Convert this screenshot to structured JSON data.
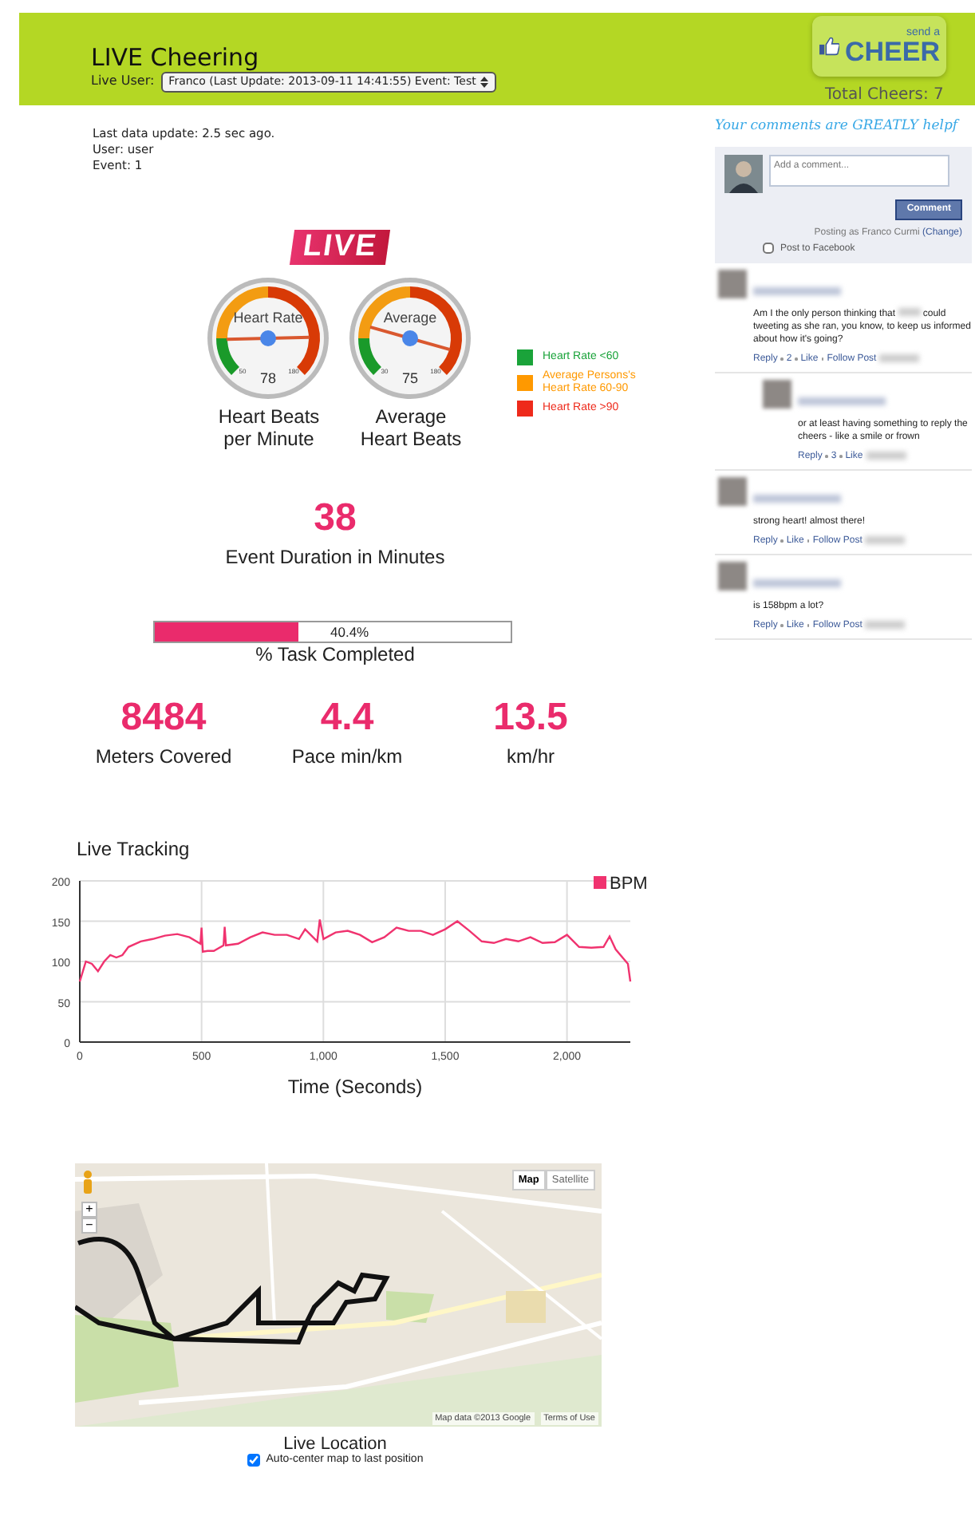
{
  "header": {
    "title": "LIVE Cheering",
    "user_label": "Live User:",
    "user_select": "Franco (Last Update: 2013-09-11 14:41:55) Event: Test",
    "cheer_button": {
      "small": "send a",
      "big": "CHEER"
    },
    "total_cheers": "Total Cheers: 7"
  },
  "info": [
    "Last data update: 2.5 sec ago.",
    "User: user",
    "Event: 1"
  ],
  "live_badge": "LIVE",
  "gauges": [
    {
      "label": "Heart Rate",
      "value": "78",
      "min_label": "50",
      "max_label": "180",
      "caption": "Heart Beats per Minute"
    },
    {
      "label": "Average",
      "value": "75",
      "min_label": "30",
      "max_label": "180",
      "caption": "Average Heart Beats"
    }
  ],
  "legend": [
    {
      "text": "Heart Rate <60",
      "color": "#1aa33a"
    },
    {
      "text": "Average Persons's Heart Rate 60-90",
      "color": "#ff9900"
    },
    {
      "text": "Heart Rate >90",
      "color": "#ee2a1b"
    }
  ],
  "duration": {
    "value": "38",
    "label": "Event Duration in Minutes"
  },
  "progress": {
    "level": 0.404,
    "reading": "40.4%",
    "label": "% Task Completed"
  },
  "stats": [
    {
      "value": "8484",
      "label": "Meters Covered"
    },
    {
      "value": "4.4",
      "label": "Pace min/km"
    },
    {
      "value": "13.5",
      "label": "km/hr"
    }
  ],
  "tracking": {
    "title": "Live Tracking",
    "chart_data": {
      "type": "line",
      "grid": true,
      "xlabel": "Time (Seconds)",
      "xlim": [
        0,
        2260
      ],
      "ylim": [
        0,
        200
      ],
      "xticks": [
        {
          "value": 0,
          "label": "0"
        },
        {
          "value": 500,
          "label": "500"
        },
        {
          "value": 1000,
          "label": "1,000"
        },
        {
          "value": 1500,
          "label": "1,500"
        },
        {
          "value": 2000,
          "label": "2,000"
        }
      ],
      "yticks": [
        0,
        50,
        100,
        150,
        200
      ],
      "x": [
        0,
        25,
        50,
        75,
        100,
        125,
        150,
        175,
        200,
        250,
        300,
        350,
        400,
        450,
        495,
        500,
        505,
        525,
        550,
        590,
        595,
        600,
        650,
        700,
        750,
        800,
        850,
        900,
        925,
        975,
        985,
        1000,
        1050,
        1100,
        1150,
        1200,
        1250,
        1300,
        1350,
        1400,
        1450,
        1500,
        1550,
        1600,
        1650,
        1700,
        1750,
        1800,
        1850,
        1900,
        1950,
        2000,
        2050,
        2100,
        2150,
        2175,
        2200,
        2250,
        2260
      ],
      "series": [
        {
          "name": "BPM",
          "color": "#f0336f",
          "values": [
            75,
            100,
            97,
            88,
            100,
            108,
            105,
            108,
            118,
            125,
            128,
            132,
            134,
            130,
            122,
            142,
            112,
            113,
            113,
            120,
            143,
            120,
            122,
            130,
            136,
            133,
            133,
            128,
            140,
            125,
            152,
            128,
            136,
            138,
            133,
            124,
            130,
            142,
            138,
            138,
            133,
            140,
            150,
            138,
            125,
            123,
            128,
            125,
            130,
            123,
            124,
            133,
            118,
            117,
            118,
            131,
            115,
            97,
            75
          ]
        }
      ]
    }
  },
  "map": {
    "kind": "picture",
    "type_buttons": [
      {
        "label": "Map",
        "selected": true
      },
      {
        "label": "Satellite",
        "selected": false
      }
    ],
    "zoom_in": "+",
    "zoom_out": "−",
    "attribution": "Map data ©2013 Google",
    "terms": "Terms of Use",
    "caption": "Live Location",
    "autocenter": {
      "label": "Auto-center map to last position",
      "checked": true
    }
  },
  "sidebar": {
    "tagline": "Your comments are GREATLY helpf",
    "comment_box": {
      "placeholder": "Add a comment...",
      "button": "Comment",
      "posting_as": "Posting as Franco Curmi",
      "change": "(Change)",
      "post_to_facebook": {
        "label": "Post to Facebook",
        "checked": false
      }
    },
    "comments": [
      {
        "text": "Am I the only person thinking that",
        "text_after": "could tweeting as she ran, you know, to keep us informed about how it's going?",
        "actions": [
          "Reply",
          "2",
          "Like",
          "Follow Post"
        ],
        "replies": [
          {
            "text": "or at least having something to reply the cheers - like a smile or frown",
            "actions": [
              "Reply",
              "3",
              "Like"
            ]
          }
        ]
      },
      {
        "text": "strong heart! almost there!",
        "actions": [
          "Reply",
          "Like",
          "Follow Post"
        ]
      },
      {
        "text": "is 158bpm a lot?",
        "actions": [
          "Reply",
          "Like",
          "Follow Post"
        ]
      }
    ]
  }
}
